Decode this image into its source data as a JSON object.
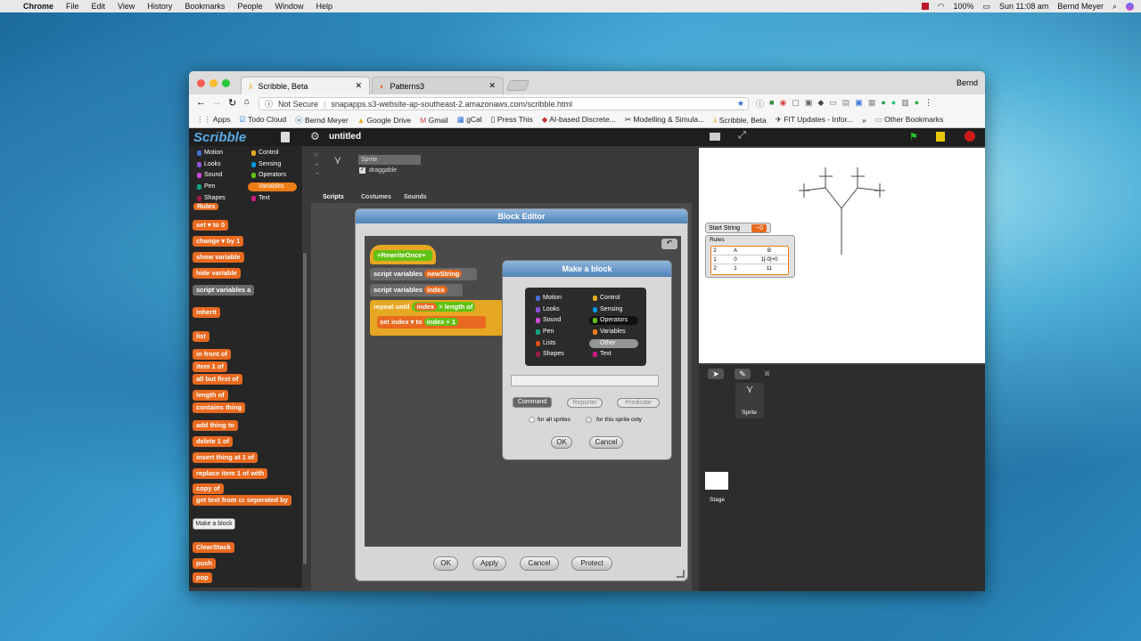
{
  "menubar": {
    "apple": "",
    "app": "Chrome",
    "items": [
      "File",
      "Edit",
      "View",
      "History",
      "Bookmarks",
      "People",
      "Window",
      "Help"
    ],
    "battery": "100%",
    "clock": "Sun 11:08 am",
    "user": "Bernd Meyer"
  },
  "browser": {
    "tabs": [
      {
        "label": "Scribble, Beta"
      },
      {
        "label": "Patterns3"
      }
    ],
    "profile": "Bernd",
    "security": "Not Secure",
    "url": "snapapps.s3-website-ap-southeast-2.amazonaws.com/scribble.html",
    "bookmarks": [
      "Apps",
      "Todo Cloud",
      "Bernd Meyer",
      "Google Drive",
      "Gmail",
      "gCal",
      "Press This",
      "AI-based Discrete...",
      "Modelling & Simula...",
      "Scribble, Beta",
      "FIT Updates - Infor...",
      "Other Bookmarks"
    ],
    "bookmarks_more": "»"
  },
  "app": {
    "logo": "Scribble",
    "project": "untitled",
    "categories_left": [
      "Motion",
      "Looks",
      "Sound",
      "Pen",
      "Shapes"
    ],
    "categories_right": [
      "Control",
      "Sensing",
      "Operators",
      "Variables",
      "Text"
    ],
    "sprite_name": "Sprite",
    "draggable_label": "draggable",
    "tabs": [
      "Scripts",
      "Costumes",
      "Sounds"
    ],
    "palette_blocks": {
      "rules": "Rules",
      "set": "set",
      "set_to": "to",
      "set_value": "0",
      "change": "change",
      "change_by": "by",
      "change_value": "1",
      "show_variable": "show variable",
      "hide_variable": "hide variable",
      "script_variables": "script variables",
      "script_variables_arg": "a",
      "inherit": "inherit",
      "list": "list",
      "in_front_of": "in front of",
      "item": "item",
      "item_arg": "1",
      "item_of": "of",
      "all_but_first_of": "all but first of",
      "length_of": "length of",
      "contains": "contains",
      "contains_arg": "thing",
      "add": "add",
      "add_arg": "thing",
      "add_to": "to",
      "delete": "delete",
      "delete_arg": "1",
      "delete_of": "of",
      "insert": "insert",
      "insert_arg": "thing",
      "insert_at": "at",
      "insert_pos": "1",
      "insert_of": "of",
      "replace_item": "replace item",
      "replace_arg": "1",
      "replace_of": "of",
      "replace_with": "with",
      "copy_of": "copy of",
      "get_text_from": "get text from",
      "separated_by": "seperated by",
      "make_a_block": "Make a block",
      "clear_stack": "ClearStack",
      "push": "push",
      "pop": "pop"
    }
  },
  "block_editor": {
    "title": "Block Editor",
    "hat": "RewriteOnce",
    "script_vars_1": "script variables",
    "script_vars_1_arg": "newString",
    "script_vars_2": "script variables",
    "script_vars_2_arg": "index",
    "repeat_until": "repeat until",
    "repeat_arg": "index",
    "repeat_op": ">",
    "repeat_length_of": "length of",
    "set_label": "set",
    "set_var": "index",
    "set_to": "to",
    "set_expr_var": "index",
    "set_expr_op": "+",
    "set_expr_val": "1",
    "buttons": [
      "OK",
      "Apply",
      "Cancel",
      "Protect"
    ]
  },
  "make_block": {
    "title": "Make a block",
    "cats_left": [
      "Motion",
      "Looks",
      "Sound",
      "Pen",
      "Lists",
      "Shapes"
    ],
    "cats_right": [
      "Control",
      "Sensing",
      "Operators",
      "Variables",
      "Other",
      "Text"
    ],
    "name_placeholder": "",
    "types": [
      "Command",
      "Reporter",
      "Predicate"
    ],
    "scope_all": "for all sprites",
    "scope_this": "for this sprite only",
    "ok": "OK",
    "cancel": "Cancel"
  },
  "stage": {
    "start_string_label": "Start String",
    "start_string_value": "--0",
    "rules_label": "Rules",
    "rules_table": {
      "size": "2",
      "headers": [
        "A",
        "B"
      ],
      "rows": [
        [
          "1",
          "0",
          "1[-0]+0"
        ],
        [
          "2",
          "1",
          "11"
        ]
      ]
    }
  },
  "corral": {
    "sprite_label": "Sprite",
    "stage_label": "Stage"
  },
  "colors": {
    "motion": "#4a6cd4",
    "looks": "#8a55d7",
    "sound": "#cf4ad9",
    "pen": "#0fa386",
    "control": "#e6a822",
    "sensing": "#0494dc",
    "operators": "#62c213",
    "variables": "#ee7d16",
    "lists": "#d94d11",
    "other": "#959595",
    "text": "#c81c7e",
    "shapes": "#9c1c4b"
  }
}
